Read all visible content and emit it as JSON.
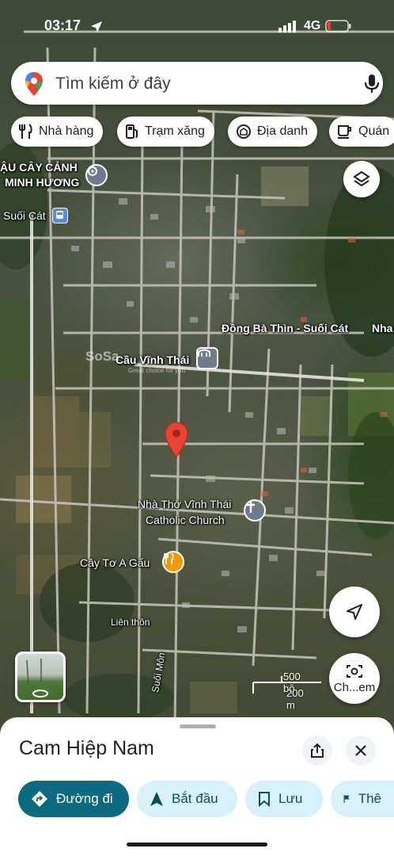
{
  "status_bar": {
    "time": "03:17",
    "network": "4G"
  },
  "search": {
    "placeholder": "Tìm kiếm ở đây"
  },
  "chips": [
    {
      "label": "Nhà hàng",
      "icon": "restaurant-icon"
    },
    {
      "label": "Trạm xăng",
      "icon": "gas-station-icon"
    },
    {
      "label": "Địa danh",
      "icon": "landmark-icon"
    },
    {
      "label": "Quán",
      "icon": "coffee-icon"
    }
  ],
  "map": {
    "labels": {
      "nursery": "ẬU CÂY CẢNH",
      "nursery2": "MINH HƯƠNG",
      "suoi_cat": "Suối Cát",
      "dong_ba_thin": "Đồng Bà Thìn - Suối Cát",
      "nha_edge": "Nha",
      "cau_vinh_thai": "Cầu Vĩnh Thái",
      "church1": "Nhà Thờ Vĩnh Thái",
      "church2": "Catholic Church",
      "cay_to": "Cây Tơ A Gấu",
      "lien_thon": "Liên thôn",
      "suoi_mon": "Suối Môn",
      "watermark": "SoSa",
      "watermark_sub": "Great choice for you"
    },
    "scale": {
      "top": "500 bộ",
      "bottom": "200 m"
    },
    "camera_label": "Ch...em"
  },
  "place": {
    "title": "Cam Hiệp Nam",
    "actions": [
      {
        "label": "Đường đi",
        "icon": "directions-icon"
      },
      {
        "label": "Bắt đầu",
        "icon": "navigation-arrow-icon"
      },
      {
        "label": "Lưu",
        "icon": "bookmark-icon"
      },
      {
        "label": "Thê",
        "icon": "flag-icon"
      }
    ]
  },
  "colors": {
    "primary": "#0c6b7f",
    "action_bg": "#d8f0f7",
    "pin_red": "#ea4335",
    "poi_blue": "#5b8bd6",
    "poi_orange": "#f29900",
    "poi_grey": "#6f7a8c"
  }
}
